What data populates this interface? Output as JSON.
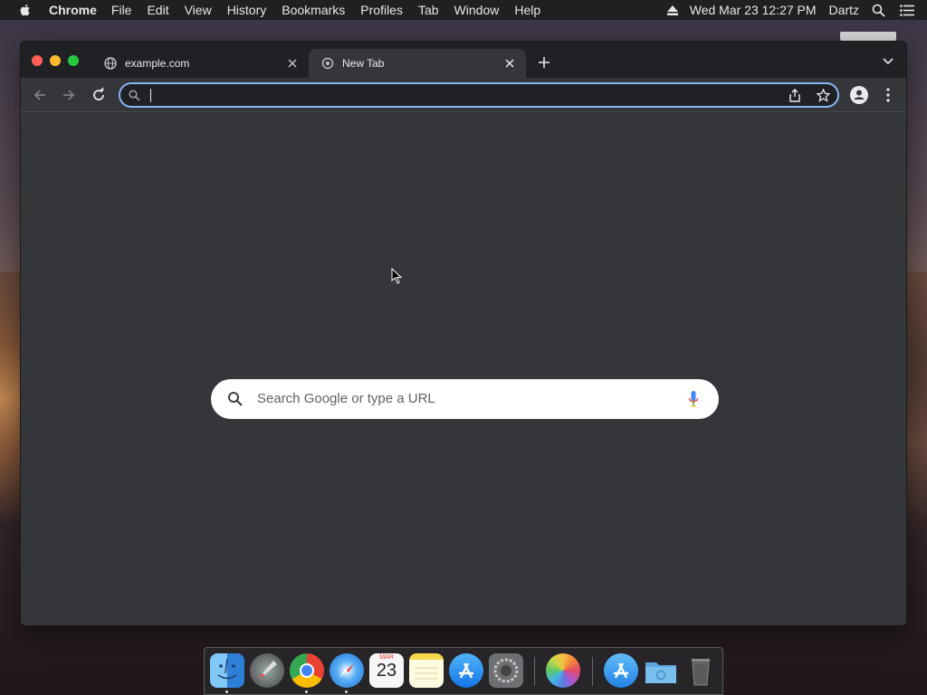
{
  "menubar": {
    "app_name": "Chrome",
    "menus": [
      "File",
      "Edit",
      "View",
      "History",
      "Bookmarks",
      "Profiles",
      "Tab",
      "Window",
      "Help"
    ],
    "clock": "Wed Mar 23  12:27 PM",
    "user": "Dartz"
  },
  "browser": {
    "tabs": [
      {
        "title": "example.com",
        "favicon": "globe-icon",
        "active": false
      },
      {
        "title": "New Tab",
        "favicon": "chrome-icon",
        "active": true
      }
    ],
    "omnibox": {
      "value": "",
      "placeholder": ""
    },
    "accent": "#8ab4f8"
  },
  "ntp": {
    "search_placeholder": "Search Google or type a URL"
  },
  "dock": {
    "apps": [
      {
        "name": "finder-icon",
        "running": true
      },
      {
        "name": "launchpad-icon",
        "running": false
      },
      {
        "name": "chrome-icon",
        "running": true
      },
      {
        "name": "safari-icon",
        "running": true
      },
      {
        "name": "calendar-icon",
        "running": false,
        "month": "MAR",
        "day": "23"
      },
      {
        "name": "notes-icon",
        "running": false
      },
      {
        "name": "app-store-icon",
        "running": false
      },
      {
        "name": "system-preferences-icon",
        "running": false
      },
      {
        "name": "photos-icon",
        "running": false
      },
      {
        "name": "applications-folder-icon",
        "running": false
      },
      {
        "name": "downloads-folder-icon",
        "running": false
      },
      {
        "name": "trash-icon",
        "running": false
      }
    ]
  }
}
